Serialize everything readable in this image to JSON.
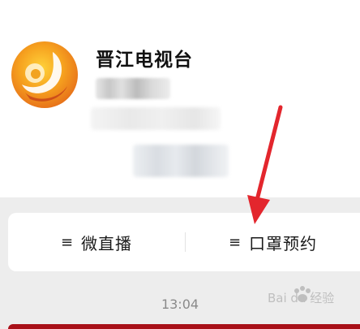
{
  "account": {
    "name": "晋江电视台"
  },
  "menu": {
    "items": [
      {
        "label": "微直播",
        "icon": "menu-lines-icon"
      },
      {
        "label": "口罩预约",
        "icon": "menu-lines-icon"
      }
    ]
  },
  "chat": {
    "timestamp": "13:04"
  },
  "watermark": {
    "text": "Bai du 经验"
  },
  "colors": {
    "menu_bg": "#ededed",
    "arrow_red": "#e3262d",
    "banner_red": "#a81018",
    "logo_orange": "#f28a1c"
  }
}
